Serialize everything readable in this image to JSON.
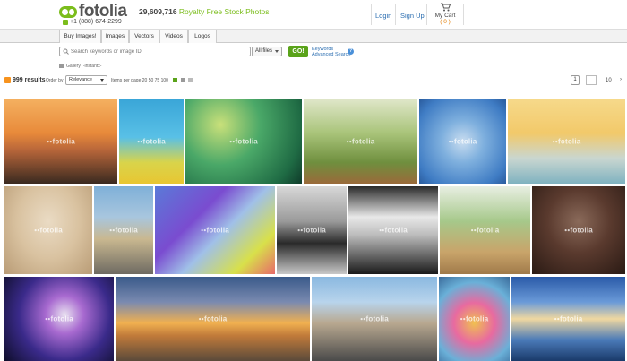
{
  "header": {
    "logo_text": "fotolia",
    "phone": "+1 (888) 674-2299",
    "tagline_count": "29,609,716",
    "tagline_rest": " Royalty Free Stock Photos",
    "login": "Login",
    "signup": "Sign Up",
    "cart_label": "My Cart",
    "cart_count": "( 0 )"
  },
  "nav": {
    "tabs": [
      "Buy Images!",
      "Images",
      "Vectors",
      "Videos",
      "Logos"
    ]
  },
  "search": {
    "placeholder": "Search keywords or image ID",
    "filetype": "All files",
    "go": "GO!",
    "keywords_link": "Keywords",
    "advanced_link": "Advanced Search"
  },
  "breadcrumb": {
    "gallery": "Gallery",
    "name": "-instantx-"
  },
  "toolbar": {
    "results": "999 results",
    "order_by": "Order by",
    "order_value": "Relevance",
    "per_page": "Items per page  20  50  75  100",
    "page_current": "1",
    "page_total": "10",
    "next": "›"
  },
  "watermark": "fotolia",
  "colors": {
    "brand_green": "#7bbd1c",
    "link_blue": "#2a6db0",
    "go_green": "#5aa31a"
  }
}
